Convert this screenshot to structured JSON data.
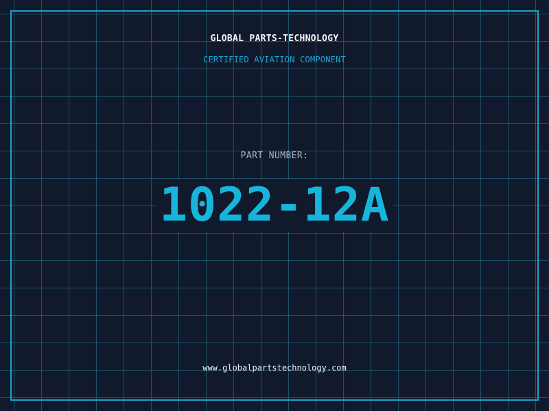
{
  "brand": {
    "name": "GLOBAL PARTS-TECHNOLOGY",
    "subtitle": "CERTIFIED AVIATION COMPONENT"
  },
  "part": {
    "label": "PART NUMBER:",
    "number": "1022-12A"
  },
  "footer": {
    "url": "www.globalpartstechnology.com"
  },
  "colors": {
    "background": "#111a2c",
    "grid": "#236e87",
    "accent": "#17b5dc",
    "text": "#f2f5f8"
  }
}
